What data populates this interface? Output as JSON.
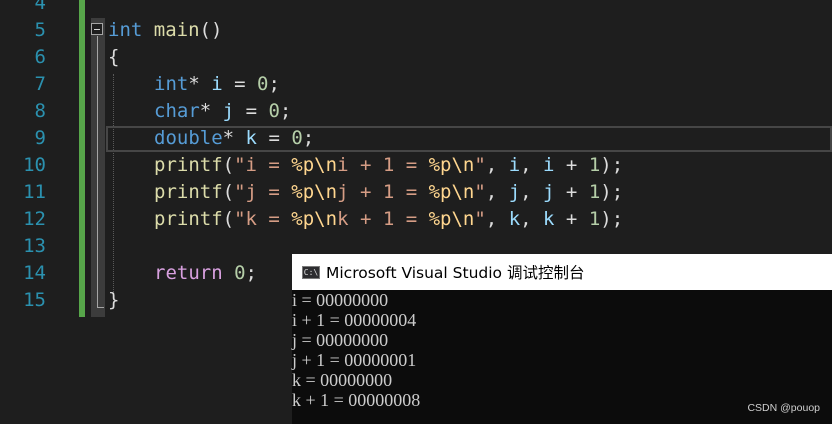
{
  "editor": {
    "line_numbers": [
      "4",
      "5",
      "6",
      "7",
      "8",
      "9",
      "10",
      "11",
      "12",
      "13",
      "14",
      "15"
    ],
    "l5": {
      "kw": "int",
      "fn": "main",
      "rest": "()"
    },
    "l6": {
      "punct": "{"
    },
    "l7": {
      "kw": "int",
      "star": "*",
      "var": "i",
      "eq": " = ",
      "num": "0",
      "semi": ";"
    },
    "l8": {
      "kw": "char",
      "star": "*",
      "var": "j",
      "eq": " = ",
      "num": "0",
      "semi": ";"
    },
    "l9": {
      "kw": "double",
      "star": "*",
      "var": "k",
      "eq": " = ",
      "num": "0",
      "semi": ";"
    },
    "l10": {
      "fn": "printf",
      "open": "(",
      "s1": "\"i = ",
      "e1": "%p\\n",
      "s2": "i + 1 = ",
      "e2": "%p\\n",
      "s3": "\"",
      "c1": ", ",
      "v1": "i",
      "c2": ", ",
      "v2": "i",
      "plus": " + ",
      "num": "1",
      "close": ");"
    },
    "l11": {
      "fn": "printf",
      "open": "(",
      "s1": "\"j = ",
      "e1": "%p\\n",
      "s2": "j + 1 = ",
      "e2": "%p\\n",
      "s3": "\"",
      "c1": ", ",
      "v1": "j",
      "c2": ", ",
      "v2": "j",
      "plus": " + ",
      "num": "1",
      "close": ");"
    },
    "l12": {
      "fn": "printf",
      "open": "(",
      "s1": "\"k = ",
      "e1": "%p\\n",
      "s2": "k + 1 = ",
      "e2": "%p\\n",
      "s3": "\"",
      "c1": ", ",
      "v1": "k",
      "c2": ", ",
      "v2": "k",
      "plus": " + ",
      "num": "1",
      "close": ");"
    },
    "l14": {
      "ctl": "return",
      "sp": " ",
      "num": "0",
      "semi": ";"
    },
    "l15": {
      "punct": "}"
    }
  },
  "console": {
    "icon_text": "C:\\",
    "title": "Microsoft Visual Studio 调试控制台",
    "lines": [
      "i = 00000000",
      "i + 1 = 00000004",
      "j = 00000000",
      "j + 1 = 00000001",
      "k = 00000000",
      "k + 1 = 00000008"
    ]
  },
  "watermark": "CSDN @pouop"
}
